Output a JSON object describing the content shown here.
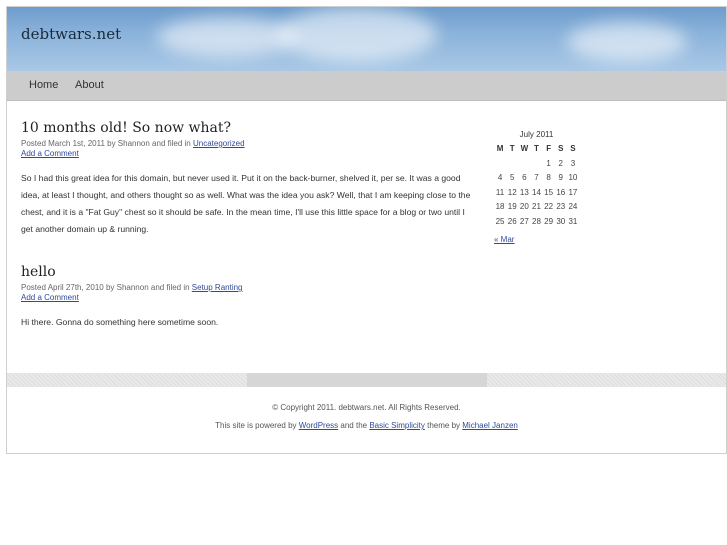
{
  "site": {
    "title": "debtwars.net"
  },
  "nav": {
    "items": [
      {
        "label": "Home"
      },
      {
        "label": "About"
      }
    ]
  },
  "posts": [
    {
      "title": "10 months old! So now what?",
      "meta_prefix": "Posted March 1st, 2011 by Shannon and filed in ",
      "category": "Uncategorized",
      "add_comment": "Add a Comment",
      "body": "So I had this great idea for this domain, but never used it. Put it on the back-burner, shelved it, per se.  It was a good idea, at least I thought, and others thought so as well. What was the idea you ask? Well, that I am keeping close to the chest, and it is a \"Fat Guy\" chest so it should be safe. In the mean time, I'll use this little space for a blog or two until I get another domain up & running."
    },
    {
      "title": "hello",
      "meta_prefix": "Posted April 27th, 2010 by Shannon and filed in ",
      "category": "Setup Ranting",
      "add_comment": "Add a Comment",
      "body": "Hi there. Gonna do something here sometime soon."
    }
  ],
  "calendar": {
    "caption": "July 2011",
    "weekdays": [
      "M",
      "T",
      "W",
      "T",
      "F",
      "S",
      "S"
    ],
    "weeks": [
      [
        "",
        "",
        "",
        "",
        "1",
        "2",
        "3"
      ],
      [
        "4",
        "5",
        "6",
        "7",
        "8",
        "9",
        "10"
      ],
      [
        "11",
        "12",
        "13",
        "14",
        "15",
        "16",
        "17"
      ],
      [
        "18",
        "19",
        "20",
        "21",
        "22",
        "23",
        "24"
      ],
      [
        "25",
        "26",
        "27",
        "28",
        "29",
        "30",
        "31"
      ]
    ],
    "prev_link": "« Mar"
  },
  "footer": {
    "copyright": "© Copyright 2011. debtwars.net. All Rights Reserved.",
    "powered_prefix": "This site is powered by ",
    "wordpress": "WordPress",
    "and_the": " and the ",
    "theme": "Basic Simplicity",
    "theme_by": " theme by ",
    "author": "Michael Janzen"
  },
  "colors": {
    "link": "#2e4a9c",
    "nav_bg": "#cccccc",
    "sky": "#8ab2da"
  }
}
